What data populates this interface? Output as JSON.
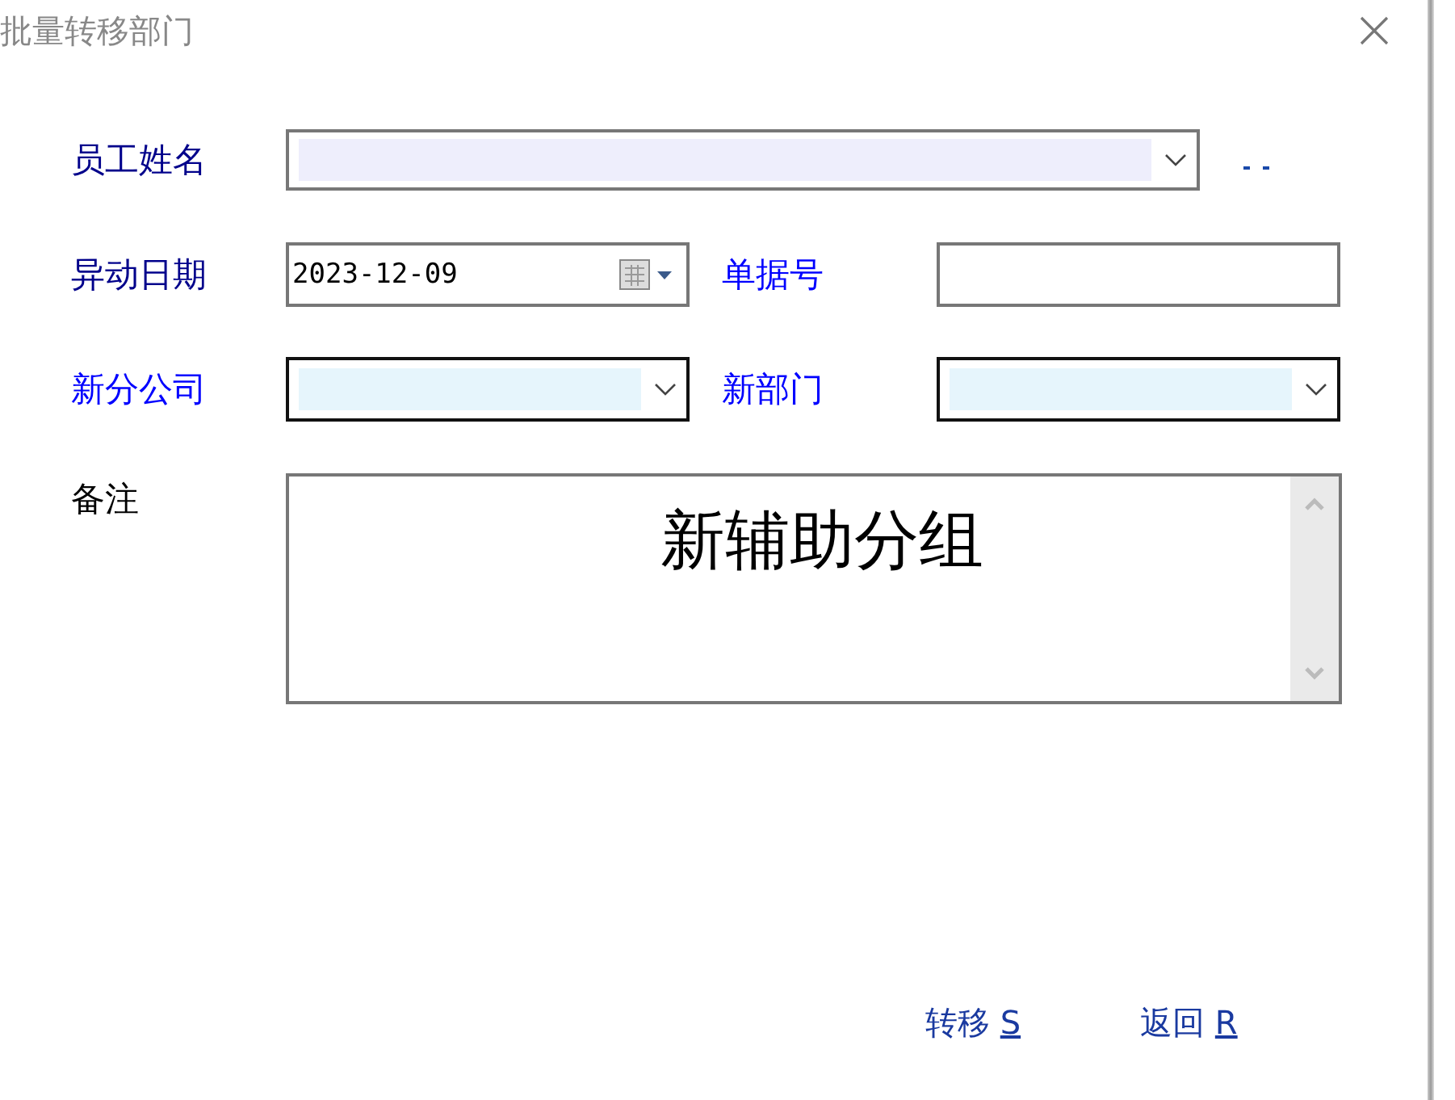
{
  "window": {
    "title": "批量转移部门"
  },
  "fields": [
    {
      "label": "员工姓名",
      "color": "#00008b",
      "kind": "combo"
    },
    {
      "label": "异动日期",
      "color": "#00008b",
      "kind": "date",
      "value": "2023-12-09"
    },
    {
      "label": "单据号",
      "color": "#0000ff",
      "kind": "text"
    },
    {
      "label": "新分公司",
      "color": "#0000ff",
      "kind": "combo"
    },
    {
      "label": "新部门",
      "color": "#0000ff",
      "kind": "combo"
    }
  ],
  "notes": {
    "label": "备注",
    "value": "新辅助分组"
  },
  "buttons": [
    {
      "label": "转移",
      "hotkey": "S"
    },
    {
      "label": "返回",
      "hotkey": "R"
    }
  ]
}
